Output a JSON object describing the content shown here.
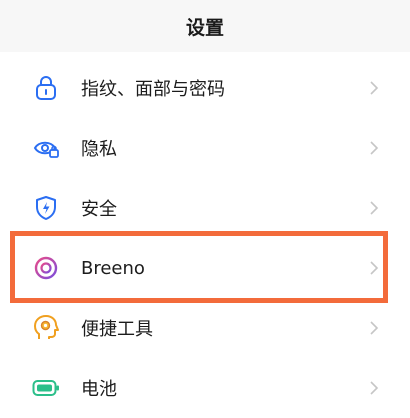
{
  "header": {
    "title": "设置"
  },
  "items": [
    {
      "label": "指纹、面部与密码",
      "icon": "lock-icon"
    },
    {
      "label": "隐私",
      "icon": "eye-lock-icon"
    },
    {
      "label": "安全",
      "icon": "shield-icon"
    },
    {
      "label": "Breeno",
      "icon": "breeno-icon"
    },
    {
      "label": "便捷工具",
      "icon": "head-gear-icon"
    },
    {
      "label": "电池",
      "icon": "battery-icon"
    }
  ],
  "colors": {
    "accent_blue": "#2b6ef2",
    "highlight": "#f36b3b",
    "breeno": "#a64ad8",
    "tools": "#f0a020",
    "battery": "#2bbf8a"
  }
}
